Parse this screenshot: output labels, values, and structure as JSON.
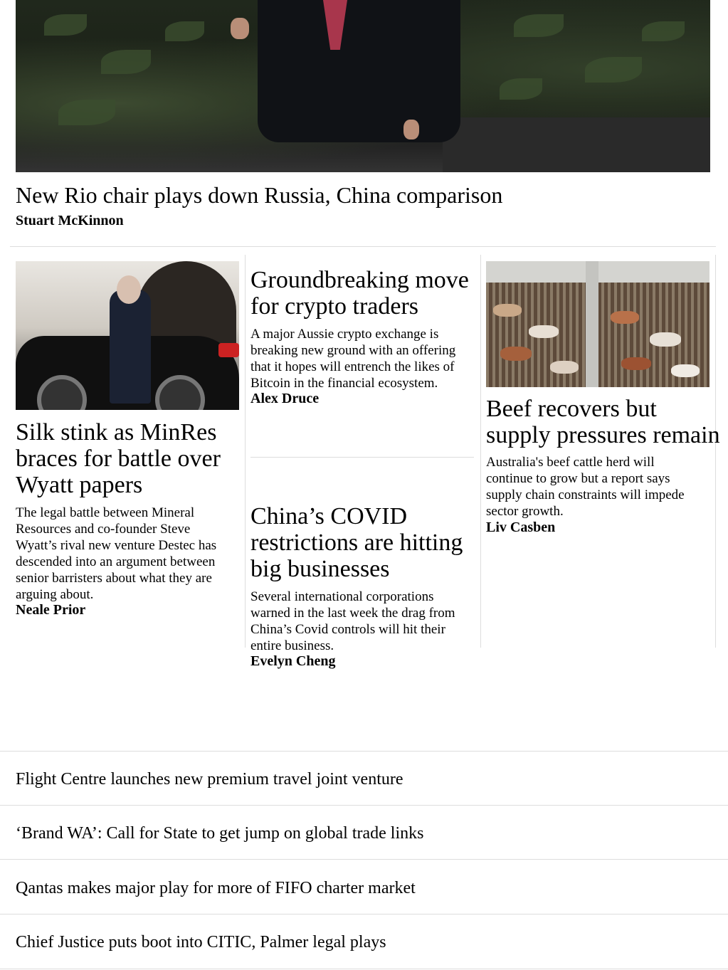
{
  "hero": {
    "image_alt": "Man in a dark suit and red tie walking past plants",
    "title": "New Rio chair plays down Russia, China comparison",
    "author": "Stuart McKinnon"
  },
  "stories": {
    "minres": {
      "image_alt": "Man in a face mask stepping out of a black car",
      "title_lines": [
        "Silk stink as MinRes",
        "braces for battle over",
        "Wyatt papers"
      ],
      "desc_lines": [
        "The legal battle between Mineral",
        "Resources and co-founder Steve",
        "Wyatt’s rival new venture Destec has",
        "descended into an argument between",
        "senior barristers about what they are",
        "arguing about."
      ],
      "author": "Neale Prior"
    },
    "crypto": {
      "title_lines": [
        "Groundbreaking move",
        "for crypto traders"
      ],
      "desc_lines": [
        "A major Aussie crypto exchange is",
        "breaking new ground with an offering",
        "that it hopes will entrench the likes of",
        "Bitcoin in the financial ecosystem."
      ],
      "author": "Alex Druce"
    },
    "covid": {
      "title_lines": [
        "China’s COVID",
        "restrictions are hitting",
        "big businesses"
      ],
      "desc_lines": [
        "Several international corporations",
        "warned in the last week the drag from",
        "China’s Covid controls will hit their",
        "entire business."
      ],
      "author": "Evelyn Cheng"
    },
    "beef": {
      "image_alt": "Cattle in saleyard pens",
      "title_lines": [
        "Beef recovers but",
        "supply pressures remain"
      ],
      "desc_lines": [
        "Australia's beef cattle herd will",
        "continue to grow but a report says",
        "supply chain constraints will impede",
        "sector growth."
      ],
      "author": "Liv Casben"
    }
  },
  "headline_list": [
    "Flight Centre launches new premium travel joint venture",
    "‘Brand WA’: Call for State to get jump on global trade links",
    "Qantas makes major play for more of FIFO charter market",
    "Chief Justice puts boot into CITIC, Palmer legal plays"
  ]
}
